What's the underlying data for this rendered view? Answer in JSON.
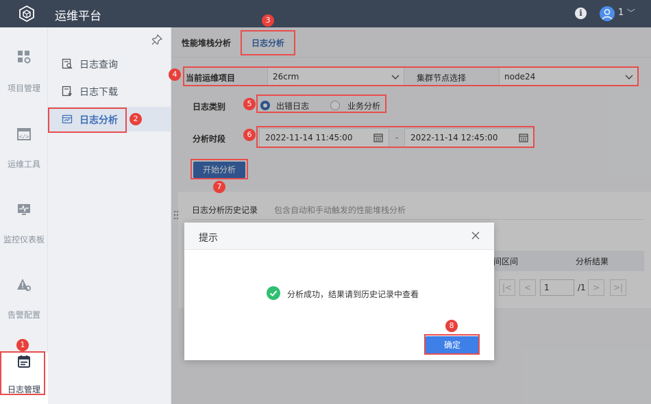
{
  "app": {
    "title": "运维平台"
  },
  "header": {
    "user_name": "1",
    "info_icon": "info-icon",
    "avatar_icon": "user-avatar-icon"
  },
  "leftnav": {
    "items": [
      {
        "label": "项目管理",
        "icon": "grid-gear-icon"
      },
      {
        "label": "运维工具",
        "icon": "code-tool-icon"
      },
      {
        "label": "监控仪表板",
        "icon": "monitor-icon"
      },
      {
        "label": "告警配置",
        "icon": "alert-gear-icon"
      },
      {
        "label": "日志管理",
        "icon": "log-icon",
        "active": true
      }
    ]
  },
  "submenu": {
    "items": [
      {
        "label": "日志查询",
        "icon": "log-search-icon"
      },
      {
        "label": "日志下载",
        "icon": "log-download-icon"
      },
      {
        "label": "日志分析",
        "icon": "log-analysis-icon",
        "active": true
      }
    ]
  },
  "tabs": [
    {
      "label": "性能堆栈分析"
    },
    {
      "label": "日志分析",
      "active": true
    }
  ],
  "form": {
    "project_label": "当前运维项目",
    "project_value": "26crm",
    "node_label": "集群节点选择",
    "node_value": "node24",
    "log_type_label": "日志类别",
    "log_type_options": [
      "出错日志",
      "业务分析"
    ],
    "log_type_selected": "出错日志",
    "period_label": "分析时段",
    "start_time": "2022-11-14 11:45:00",
    "dash": "-",
    "end_time": "2022-11-14 12:45:00",
    "start_button": "开始分析"
  },
  "history": {
    "title": "日志分析历史记录",
    "subtitle": "包含自动和手动触发的性能堆栈分析",
    "columns_visible": [
      "时间区间",
      "分析结果"
    ],
    "page_input": "1",
    "page_total": "/1"
  },
  "dialog": {
    "title": "提示",
    "message": "分析成功，结果请到历史记录中查看",
    "ok_button": "确定"
  },
  "annotations": [
    "1",
    "2",
    "3",
    "4",
    "5",
    "6",
    "7",
    "8"
  ],
  "colors": {
    "topbar": "#3a4556",
    "accent": "#3f6fb8",
    "annotation": "#e8403b",
    "ok_button": "#3f80e8",
    "success": "#2fbf71"
  }
}
